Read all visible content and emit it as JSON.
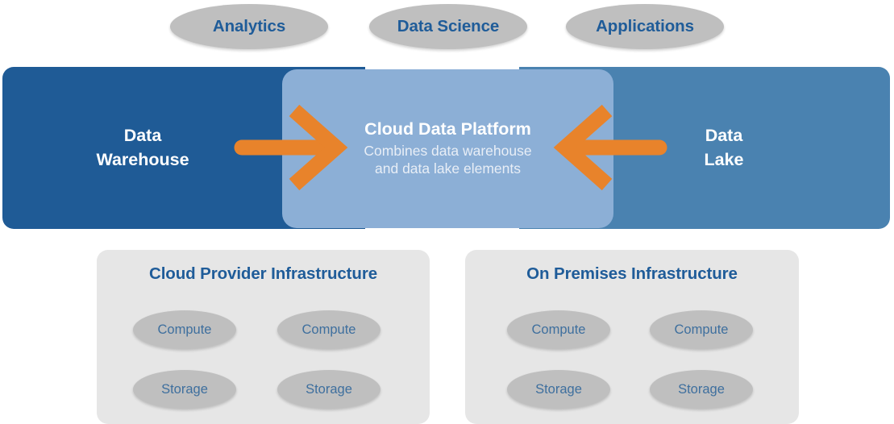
{
  "colors": {
    "data_warehouse_blue": "#1F5B96",
    "data_lake_blue": "#4A82B0",
    "platform_blue": "#8CAFD6",
    "arrow_orange": "#E8832B",
    "pill_gray": "#BFBFBF",
    "panel_gray": "#E6E6E6",
    "heading_blue": "#1F5C99",
    "resource_label_blue": "#3E6F9E",
    "page_background": "#FFFFFF"
  },
  "consumers": [
    {
      "label": "Analytics"
    },
    {
      "label": "Data Science"
    },
    {
      "label": "Applications"
    }
  ],
  "band": {
    "left": {
      "label": "Data\nWarehouse",
      "line1": "Data",
      "line2": "Warehouse"
    },
    "right": {
      "label": "Data\nLake",
      "line1": "Data",
      "line2": "Lake"
    },
    "platform": {
      "title": "Cloud Data Platform",
      "subtitle_line1": "Combines data warehouse",
      "subtitle_line2": "and data lake elements"
    },
    "arrows": [
      {
        "name": "arrow-right-into-platform",
        "direction": "right"
      },
      {
        "name": "arrow-left-into-platform",
        "direction": "left"
      }
    ]
  },
  "infrastructure": [
    {
      "title": "Cloud Provider Infrastructure",
      "resources": [
        "Compute",
        "Compute",
        "Storage",
        "Storage"
      ]
    },
    {
      "title": "On Premises Infrastructure",
      "resources": [
        "Compute",
        "Compute",
        "Storage",
        "Storage"
      ]
    }
  ]
}
